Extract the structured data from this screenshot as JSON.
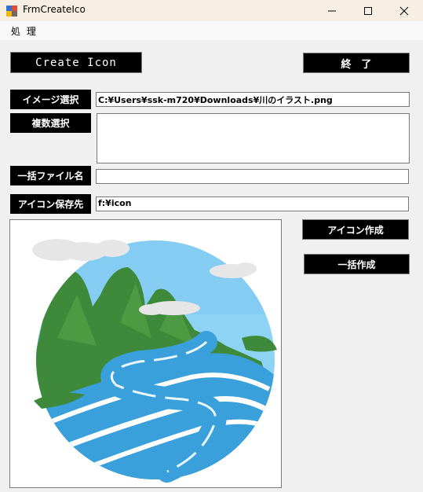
{
  "window": {
    "title": "FrmCreateIco"
  },
  "menu": {
    "items": [
      "処 理"
    ]
  },
  "toolbar": {
    "create_icon_label": "Create Icon",
    "exit_label": "終　了"
  },
  "form": {
    "image_select_label": "イメージ選択",
    "image_path": "C:¥Users¥ssk-m720¥Downloads¥川のイラスト.png",
    "multi_select_label": "複数選択",
    "multi_select_value": "",
    "batch_filename_label": "一括ファイル名",
    "batch_filename_value": "",
    "icon_save_label": "アイコン保存先",
    "icon_save_path": "f:¥icon"
  },
  "actions": {
    "make_icon_label": "アイコン作成",
    "batch_make_label": "一括作成"
  },
  "colors": {
    "sky": "#8fd3f4",
    "mountain": "#3e8a3a",
    "river": "#3aa0dc",
    "cloud": "#e6e6e6"
  }
}
